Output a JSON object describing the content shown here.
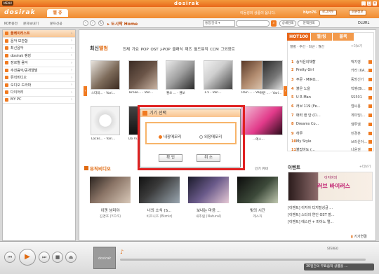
{
  "app": {
    "menu": "MENU",
    "title": "dosirak"
  },
  "header": {
    "logo": "dosirak",
    "tab": "벨 쥬",
    "welcome": "이동성의 상품이 옵니다.",
    "user": "hiyo76",
    "logout": "로그아웃",
    "member_info": "회원정보"
  },
  "toolbar": {
    "links": [
      "KOH충전",
      "문자보내기",
      "문자신공"
    ],
    "breadcrumb": "도시락 Home",
    "search_select": "통합검색",
    "detail": "상세검색",
    "context": "문맥검색",
    "dlurl": "DLURL"
  },
  "sidebar": {
    "items": [
      {
        "label": "플레이리스트",
        "active": true
      },
      {
        "label": "음악 보관함"
      },
      {
        "label": "최신음악"
      },
      {
        "label": "dosirak 랭킹"
      },
      {
        "label": "장르별 음악"
      },
      {
        "label": "추천음악/공개앨범"
      },
      {
        "label": "뮤직비디오"
      },
      {
        "label": "오디오 드라마"
      },
      {
        "label": "다이어리"
      },
      {
        "label": "MY PC"
      }
    ]
  },
  "latest": {
    "title_a": "최신",
    "title_b": "앨범",
    "genres": "전체  가요  POP  OST  J-POP  클래식  재즈  월드뮤직  CCM  그외장르",
    "row1": [
      {
        "cap": "스타의... - Vari..."
      },
      {
        "cap": "Broke... - Vari..."
      },
      {
        "cap": "괜쏘 ... - 괜쏘"
      },
      {
        "cap": "1.5 - Vari..."
      },
      {
        "cap": "Rain ... - Vari..."
      },
      {
        "cap": "Duffy ... - Duffy"
      },
      {
        "cap": "나란 ... - Vari..."
      }
    ],
    "row2": [
      {
        "cap": "Locks... - Vari..."
      },
      {
        "cap": "Do Vi..."
      },
      {
        "cap": "...에스..."
      }
    ]
  },
  "chart": {
    "tab1": "HOT100",
    "tab2": "벨/링",
    "tab3": "블쿡",
    "period": "열별 · 주간 · 최근 : 월간",
    "more": "+더보기",
    "rows": [
      {
        "rank": "1",
        "title": "송악은의책할",
        "artist": "백지영"
      },
      {
        "rank": "2",
        "title": "Pretty Girl",
        "artist": "카라 (KA..."
      },
      {
        "rank": "3",
        "title": "주문 - MIRO...",
        "artist": "동방신기"
      },
      {
        "rank": "4",
        "title": "붉은 노을",
        "artist": "빅뱅(Bi..."
      },
      {
        "rank": "5",
        "title": "U R Man",
        "artist": "SS501"
      },
      {
        "rank": "6",
        "title": "러브 119 (Fe...",
        "artist": "엠씨몽"
      },
      {
        "rank": "7",
        "title": "매력 캔 안 (Ci...",
        "artist": "게미밍(..."
      },
      {
        "rank": "8",
        "title": "Dreams Co...",
        "artist": "엠투엠"
      },
      {
        "rank": "9",
        "title": "하루",
        "artist": "민경훈"
      },
      {
        "rank": "10",
        "title": "My Style",
        "artist": "브라운아..."
      },
      {
        "rank": "11",
        "title": "불잡아도 (...",
        "artist": "나윤권"
      }
    ]
  },
  "musicvideo": {
    "title": "뮤직비디오",
    "sort": "인기 유비",
    "items": [
      {
        "title": "이젠 넘미야",
        "artist": "김경호 (Y.O.S)"
      },
      {
        "title": "너의 소식 (S...",
        "artist": "비즈니즈 (Bizniz)"
      },
      {
        "title": "보내는 마음 ...",
        "artist": "내추럴 (Natural)"
      },
      {
        "title": "빛의 시간",
        "artist": "캐스커"
      }
    ]
  },
  "event": {
    "title": "이벤트",
    "more": "+더보기",
    "banner_sub": "이지아의",
    "banner_title": "러브 바이러스",
    "lines": [
      "[이벤트] 이지아 디지털싱글 ...",
      "[이벤트] 스타의 연인 OST 발...",
      "[이벤트] 에스컨 + 피아노 앨..."
    ],
    "history": "기기연결"
  },
  "dialog": {
    "title": "기기 선택",
    "option1": "내장메모리",
    "option2": "외장메모리",
    "ok": "확 인",
    "cancel": "취 소"
  },
  "player": {
    "stereo": "STEREO",
    "promo": "30일간의 무료음악 상품을 ...",
    "logo": "dosirak"
  }
}
